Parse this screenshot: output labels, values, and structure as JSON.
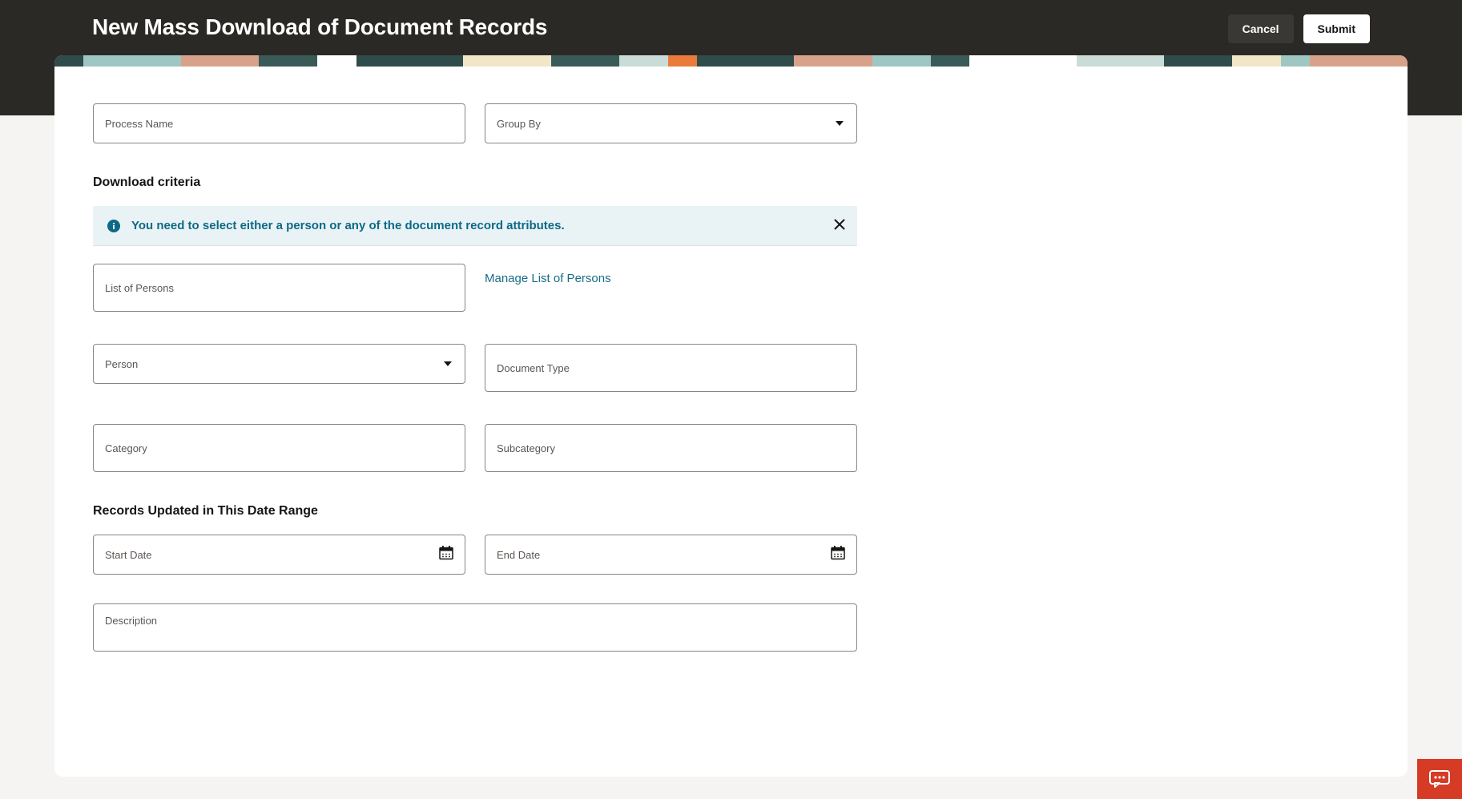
{
  "header": {
    "title": "New Mass Download of Document Records",
    "cancel": "Cancel",
    "submit": "Submit"
  },
  "form": {
    "processName": {
      "label": "Process Name"
    },
    "groupBy": {
      "label": "Group By"
    },
    "downloadCriteriaHeading": "Download criteria",
    "infoBanner": "You need to select either a person or any of the document record attributes.",
    "listOfPersons": {
      "label": "List of Persons"
    },
    "manageListLink": "Manage List of Persons",
    "person": {
      "label": "Person"
    },
    "documentType": {
      "label": "Document Type"
    },
    "category": {
      "label": "Category"
    },
    "subcategory": {
      "label": "Subcategory"
    },
    "dateRangeHeading": "Records Updated in This Date Range",
    "startDate": {
      "label": "Start Date"
    },
    "endDate": {
      "label": "End Date"
    },
    "description": {
      "label": "Description"
    }
  },
  "decor": [
    "#2f4b4a",
    "#9ec6c2",
    "#d8a28a",
    "#3a5a58",
    "#ffffff",
    "#2f4b4a",
    "#f2e6c9",
    "#3a5a58",
    "#c9dcd8",
    "#ea7b3a",
    "#2f4b4a",
    "#d8a28a",
    "#9ec6c2",
    "#3a5a58",
    "#ffffff",
    "#c9dcd8",
    "#2f4b4a",
    "#f2e6c9",
    "#9ec6c2",
    "#d8a28a"
  ]
}
